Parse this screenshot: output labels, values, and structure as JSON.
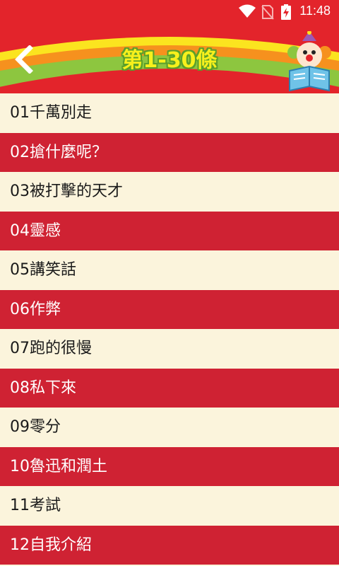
{
  "status_bar": {
    "time": "11:48",
    "icons": [
      "wifi-icon",
      "no-sim-icon",
      "battery-charging-icon"
    ]
  },
  "header": {
    "title": "第1-30條",
    "back_icon": "chevron-left-icon",
    "mascot": "clown-reading-book"
  },
  "colors": {
    "header_red": "#e3242b",
    "row_red": "#cf2233",
    "row_cream": "#fbf4dc",
    "title_yellow": "#f7f01c",
    "title_outline": "#5b9f2b"
  },
  "items": [
    {
      "label": "01千萬別走"
    },
    {
      "label": "02搶什麼呢？"
    },
    {
      "label": "03被打擊的天才"
    },
    {
      "label": "04靈感"
    },
    {
      "label": "05講笑話"
    },
    {
      "label": "06作弊"
    },
    {
      "label": "07跑的很慢"
    },
    {
      "label": "08私下來"
    },
    {
      "label": "09零分"
    },
    {
      "label": "10魯迅和潤土"
    },
    {
      "label": "11考試"
    },
    {
      "label": "12自我介紹"
    }
  ]
}
